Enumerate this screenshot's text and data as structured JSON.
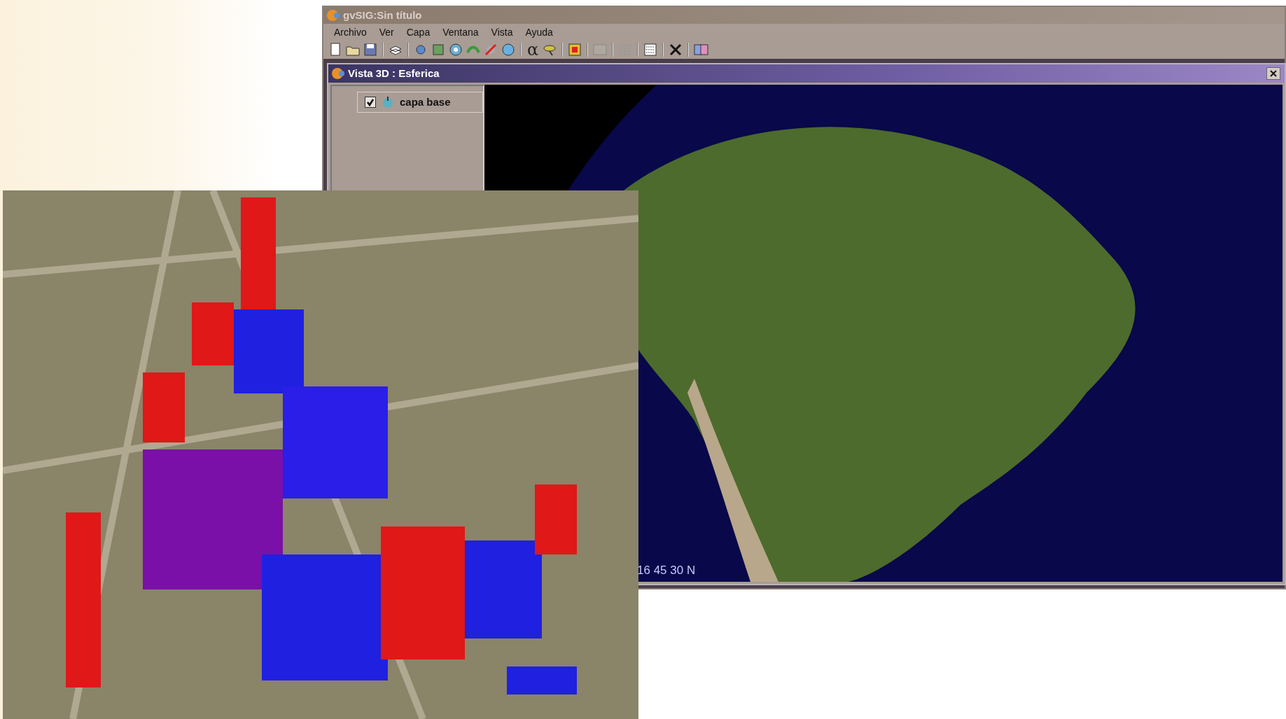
{
  "window": {
    "title": "gvSIG:Sin título"
  },
  "menu": [
    "Archivo",
    "Ver",
    "Capa",
    "Ventana",
    "Vista",
    "Ayuda"
  ],
  "toolbar": {
    "text_tool": "α"
  },
  "view_window": {
    "title": "Vista 3D : Esferica",
    "layers": [
      {
        "name": "capa base",
        "checked": true
      }
    ],
    "coordinates": "16 45 30 N"
  }
}
